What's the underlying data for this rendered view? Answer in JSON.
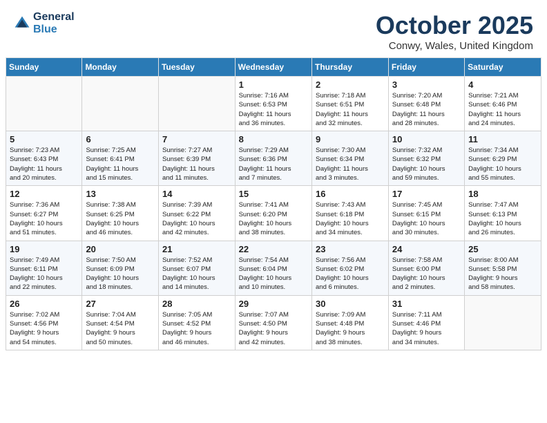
{
  "header": {
    "logo_line1": "General",
    "logo_line2": "Blue",
    "month": "October 2025",
    "location": "Conwy, Wales, United Kingdom"
  },
  "weekdays": [
    "Sunday",
    "Monday",
    "Tuesday",
    "Wednesday",
    "Thursday",
    "Friday",
    "Saturday"
  ],
  "weeks": [
    [
      {
        "day": "",
        "info": ""
      },
      {
        "day": "",
        "info": ""
      },
      {
        "day": "",
        "info": ""
      },
      {
        "day": "1",
        "info": "Sunrise: 7:16 AM\nSunset: 6:53 PM\nDaylight: 11 hours\nand 36 minutes."
      },
      {
        "day": "2",
        "info": "Sunrise: 7:18 AM\nSunset: 6:51 PM\nDaylight: 11 hours\nand 32 minutes."
      },
      {
        "day": "3",
        "info": "Sunrise: 7:20 AM\nSunset: 6:48 PM\nDaylight: 11 hours\nand 28 minutes."
      },
      {
        "day": "4",
        "info": "Sunrise: 7:21 AM\nSunset: 6:46 PM\nDaylight: 11 hours\nand 24 minutes."
      }
    ],
    [
      {
        "day": "5",
        "info": "Sunrise: 7:23 AM\nSunset: 6:43 PM\nDaylight: 11 hours\nand 20 minutes."
      },
      {
        "day": "6",
        "info": "Sunrise: 7:25 AM\nSunset: 6:41 PM\nDaylight: 11 hours\nand 15 minutes."
      },
      {
        "day": "7",
        "info": "Sunrise: 7:27 AM\nSunset: 6:39 PM\nDaylight: 11 hours\nand 11 minutes."
      },
      {
        "day": "8",
        "info": "Sunrise: 7:29 AM\nSunset: 6:36 PM\nDaylight: 11 hours\nand 7 minutes."
      },
      {
        "day": "9",
        "info": "Sunrise: 7:30 AM\nSunset: 6:34 PM\nDaylight: 11 hours\nand 3 minutes."
      },
      {
        "day": "10",
        "info": "Sunrise: 7:32 AM\nSunset: 6:32 PM\nDaylight: 10 hours\nand 59 minutes."
      },
      {
        "day": "11",
        "info": "Sunrise: 7:34 AM\nSunset: 6:29 PM\nDaylight: 10 hours\nand 55 minutes."
      }
    ],
    [
      {
        "day": "12",
        "info": "Sunrise: 7:36 AM\nSunset: 6:27 PM\nDaylight: 10 hours\nand 51 minutes."
      },
      {
        "day": "13",
        "info": "Sunrise: 7:38 AM\nSunset: 6:25 PM\nDaylight: 10 hours\nand 46 minutes."
      },
      {
        "day": "14",
        "info": "Sunrise: 7:39 AM\nSunset: 6:22 PM\nDaylight: 10 hours\nand 42 minutes."
      },
      {
        "day": "15",
        "info": "Sunrise: 7:41 AM\nSunset: 6:20 PM\nDaylight: 10 hours\nand 38 minutes."
      },
      {
        "day": "16",
        "info": "Sunrise: 7:43 AM\nSunset: 6:18 PM\nDaylight: 10 hours\nand 34 minutes."
      },
      {
        "day": "17",
        "info": "Sunrise: 7:45 AM\nSunset: 6:15 PM\nDaylight: 10 hours\nand 30 minutes."
      },
      {
        "day": "18",
        "info": "Sunrise: 7:47 AM\nSunset: 6:13 PM\nDaylight: 10 hours\nand 26 minutes."
      }
    ],
    [
      {
        "day": "19",
        "info": "Sunrise: 7:49 AM\nSunset: 6:11 PM\nDaylight: 10 hours\nand 22 minutes."
      },
      {
        "day": "20",
        "info": "Sunrise: 7:50 AM\nSunset: 6:09 PM\nDaylight: 10 hours\nand 18 minutes."
      },
      {
        "day": "21",
        "info": "Sunrise: 7:52 AM\nSunset: 6:07 PM\nDaylight: 10 hours\nand 14 minutes."
      },
      {
        "day": "22",
        "info": "Sunrise: 7:54 AM\nSunset: 6:04 PM\nDaylight: 10 hours\nand 10 minutes."
      },
      {
        "day": "23",
        "info": "Sunrise: 7:56 AM\nSunset: 6:02 PM\nDaylight: 10 hours\nand 6 minutes."
      },
      {
        "day": "24",
        "info": "Sunrise: 7:58 AM\nSunset: 6:00 PM\nDaylight: 10 hours\nand 2 minutes."
      },
      {
        "day": "25",
        "info": "Sunrise: 8:00 AM\nSunset: 5:58 PM\nDaylight: 9 hours\nand 58 minutes."
      }
    ],
    [
      {
        "day": "26",
        "info": "Sunrise: 7:02 AM\nSunset: 4:56 PM\nDaylight: 9 hours\nand 54 minutes."
      },
      {
        "day": "27",
        "info": "Sunrise: 7:04 AM\nSunset: 4:54 PM\nDaylight: 9 hours\nand 50 minutes."
      },
      {
        "day": "28",
        "info": "Sunrise: 7:05 AM\nSunset: 4:52 PM\nDaylight: 9 hours\nand 46 minutes."
      },
      {
        "day": "29",
        "info": "Sunrise: 7:07 AM\nSunset: 4:50 PM\nDaylight: 9 hours\nand 42 minutes."
      },
      {
        "day": "30",
        "info": "Sunrise: 7:09 AM\nSunset: 4:48 PM\nDaylight: 9 hours\nand 38 minutes."
      },
      {
        "day": "31",
        "info": "Sunrise: 7:11 AM\nSunset: 4:46 PM\nDaylight: 9 hours\nand 34 minutes."
      },
      {
        "day": "",
        "info": ""
      }
    ]
  ]
}
